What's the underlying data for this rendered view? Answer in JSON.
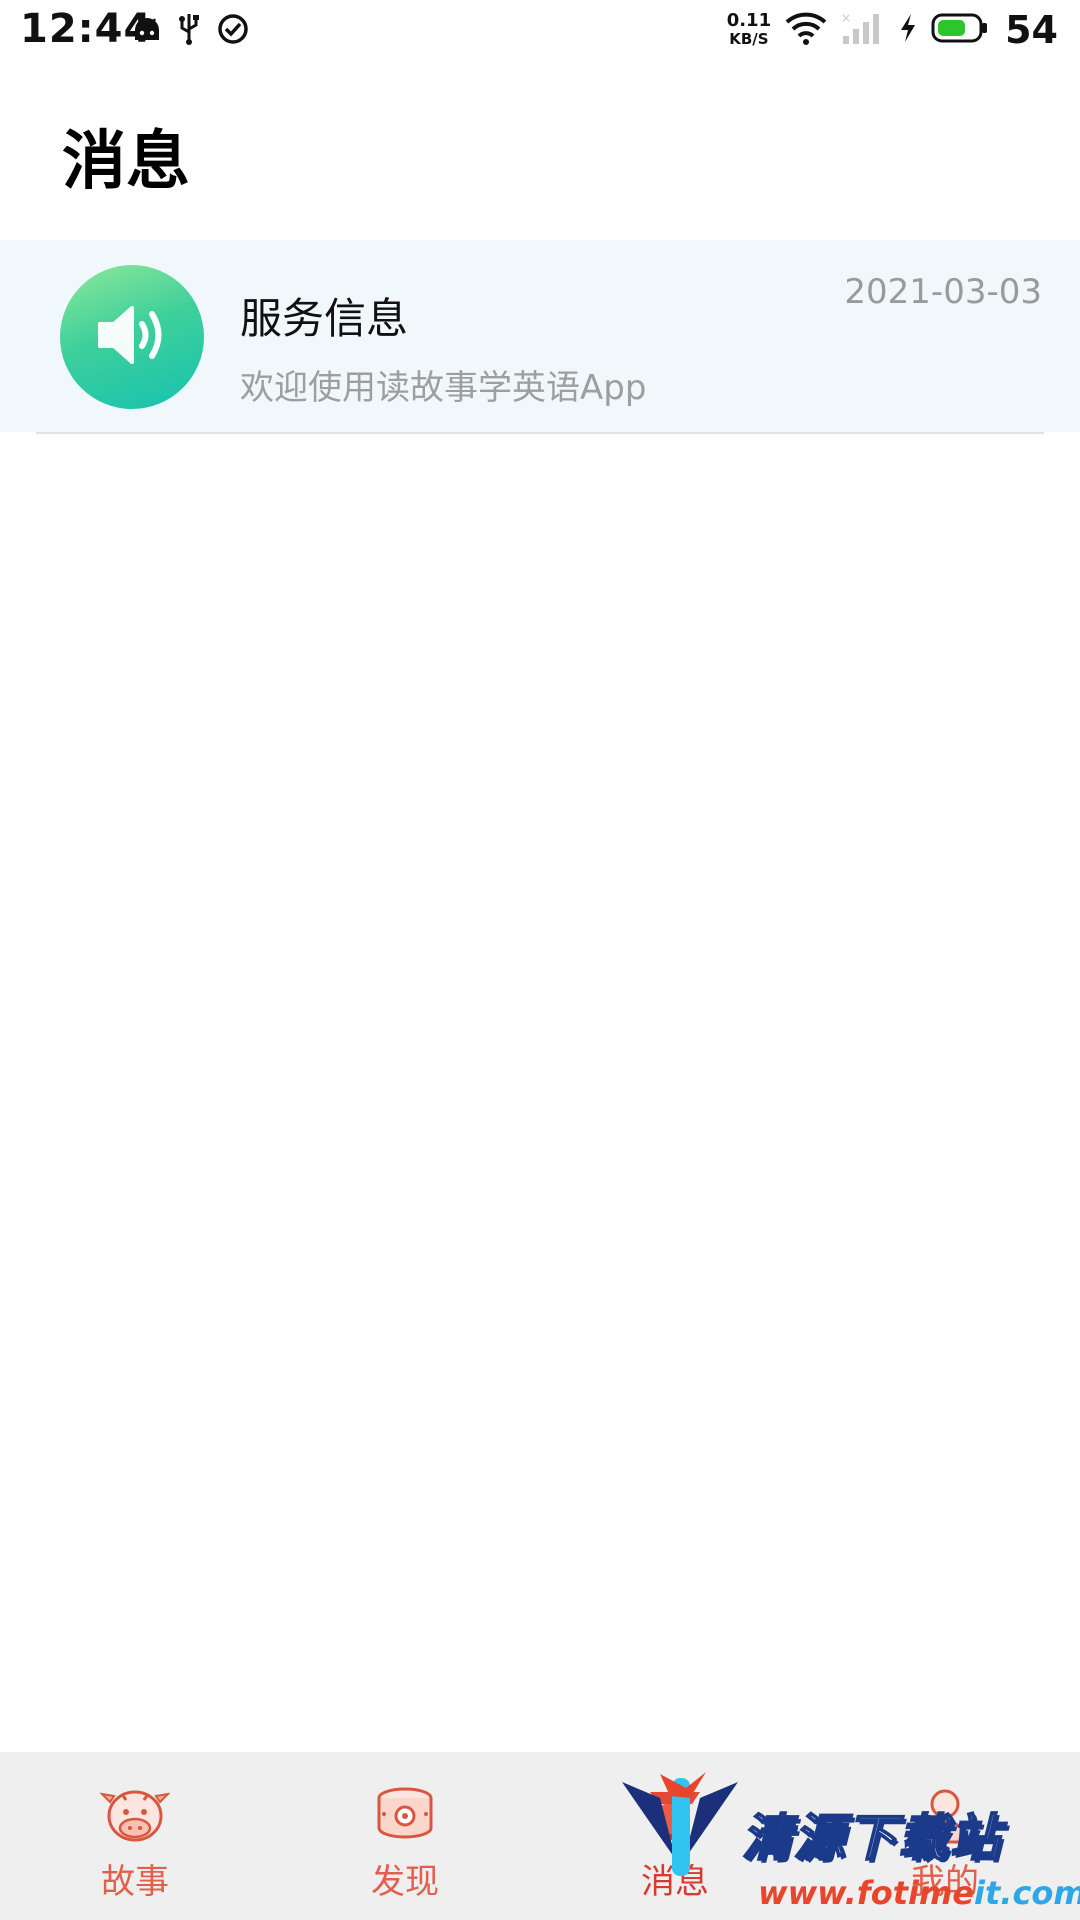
{
  "status_bar": {
    "time": "12:44",
    "net_speed_value": "0.11",
    "net_speed_unit": "KB/S",
    "battery_level": "54",
    "icons": [
      "android-icon",
      "usb-icon",
      "check-circle-icon",
      "wifi-icon",
      "signal-icon",
      "charging-icon",
      "battery-icon"
    ]
  },
  "header": {
    "title": "消息"
  },
  "messages": [
    {
      "title": "服务信息",
      "subtitle": "欢迎使用读故事学英语App",
      "date": "2021-03-03",
      "icon": "speaker-icon"
    }
  ],
  "bottom_nav": {
    "items": [
      {
        "label": "故事",
        "icon": "cow-icon",
        "active": false
      },
      {
        "label": "发现",
        "icon": "drum-icon",
        "active": false
      },
      {
        "label": "消息",
        "icon": "lantern-icon",
        "active": true
      },
      {
        "label": "我的",
        "icon": "person-icon",
        "active": false
      }
    ]
  },
  "watermark": {
    "title": "清源下载站",
    "url_part1": "www.fotime",
    "url_part2": "it.com"
  },
  "colors": {
    "accent": "#e2604b",
    "item_bg": "#f1f8fb",
    "avatar_start": "#8fe89a",
    "avatar_end": "#15c2b0"
  }
}
